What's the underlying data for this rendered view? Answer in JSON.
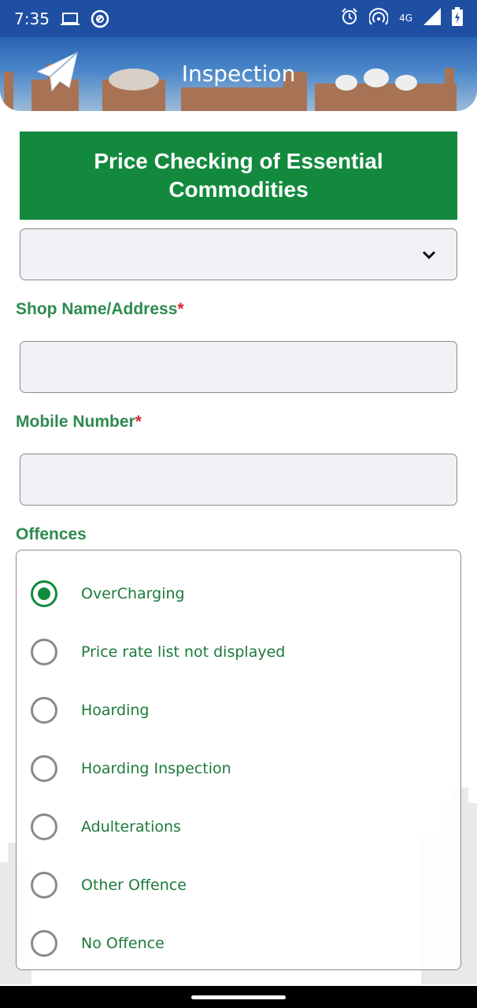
{
  "status_bar": {
    "time": "7:35",
    "network": "4G",
    "left_icons": [
      "laptop-icon",
      "do-not-disturb-icon"
    ],
    "right_icons": [
      "alarm-icon",
      "hotspot-icon",
      "signal-icon",
      "battery-charging-icon"
    ]
  },
  "header": {
    "title": "Inspection",
    "logo_icon": "paper-plane-icon",
    "color": "#1e4fa3"
  },
  "form": {
    "title": "Price Checking of Essential Commodities",
    "title_color": "#13893e",
    "dropdown": {
      "selected": "",
      "icon": "chevron-down-icon"
    },
    "shop": {
      "label": "Shop Name/Address",
      "required_mark": "*",
      "value": ""
    },
    "mobile": {
      "label": "Mobile Number",
      "required_mark": "*",
      "value": ""
    },
    "offences": {
      "label": "Offences",
      "selected_index": 0,
      "options": [
        "OverCharging",
        "Price rate list not displayed",
        "Hoarding",
        "Hoarding Inspection",
        "Adulterations",
        "Other Offence",
        "No Offence"
      ]
    }
  }
}
